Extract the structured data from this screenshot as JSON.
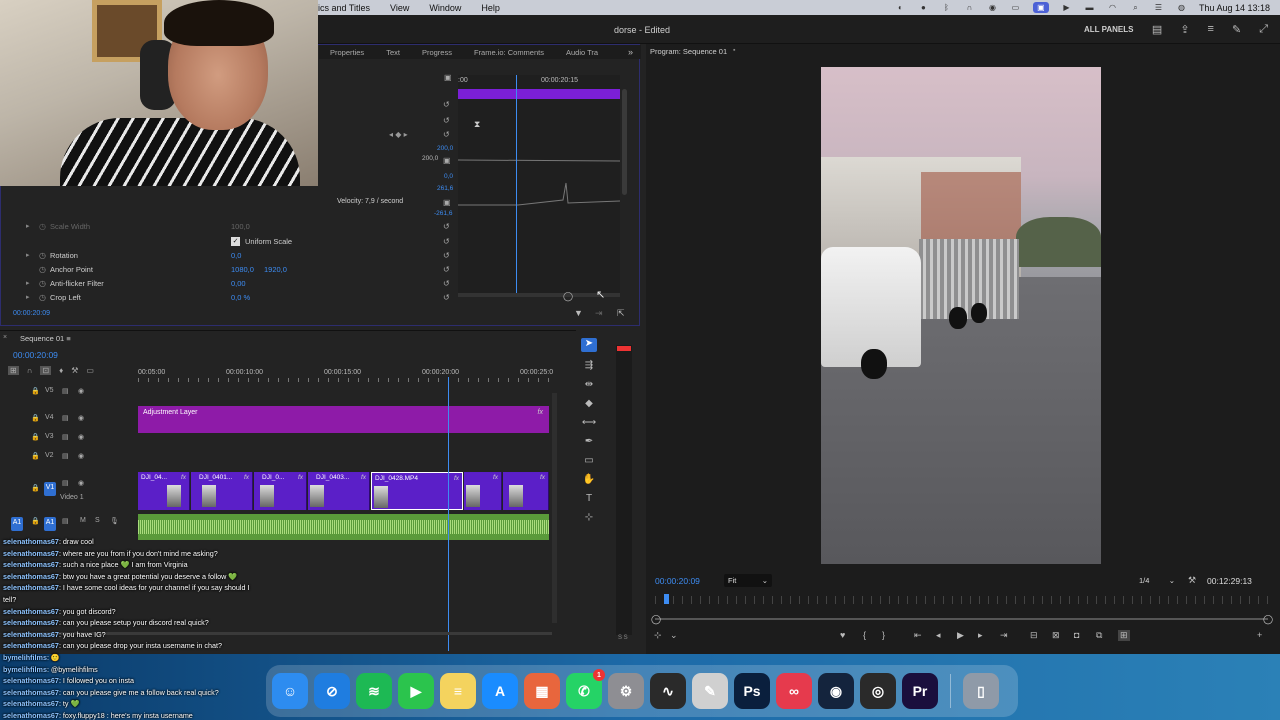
{
  "menubar": {
    "items": [
      "ics and Titles",
      "View",
      "Window",
      "Help"
    ],
    "clock": "Thu Aug 14  13:18"
  },
  "titlebar": {
    "project": "dorse - Edited",
    "all_panels": "ALL PANELS"
  },
  "effects_panel": {
    "tabs": [
      "Properties",
      "Text",
      "Progress",
      "Frame.io: Comments",
      "Audio Tra"
    ],
    "ruler_start": ":00",
    "ruler_time": "00:00:20:15",
    "values_right": [
      "200,0",
      "200,0",
      "0,0",
      "261,6",
      "-261,6"
    ],
    "velocity": "Velocity: 7,9 / second",
    "rows": [
      {
        "name": "Scale Width",
        "value": "100,0",
        "dim": true
      },
      {
        "name": "Uniform Scale",
        "checkbox": true
      },
      {
        "name": "Rotation",
        "value": "0,0"
      },
      {
        "name": "Anchor Point",
        "value": "1080,0",
        "value2": "1920,0"
      },
      {
        "name": "Anti-flicker Filter",
        "value": "0,00"
      },
      {
        "name": "Crop Left",
        "value": "0,0 %"
      }
    ],
    "current_time": "00:00:20:09"
  },
  "program": {
    "title": "Program: Sequence 01",
    "timecode": "00:00:20:09",
    "fit": "Fit",
    "resolution": "1/4",
    "duration": "00:12:29:13"
  },
  "timeline": {
    "sequence": "Sequence 01",
    "timecode": "00:00:20:09",
    "ruler": [
      "00:05:00",
      "00:00:10:00",
      "00:00:15:00",
      "00:00:20:00",
      "00:00:25:0"
    ],
    "tracks": [
      "V5",
      "V4",
      "V3",
      "V2",
      "V1",
      "A1"
    ],
    "v1_name": "Video 1",
    "target_v": "V1",
    "target_a": "A1",
    "audio_flags": [
      "M",
      "S"
    ],
    "adjustment_layer": "Adjustment Layer",
    "clips": [
      "DJI_04...",
      "DJI_0401...",
      "DJI_0...",
      "DJI_0403...",
      "DJI_0428.MP4"
    ],
    "fx": "fx"
  },
  "meter": {
    "label": "S S"
  },
  "chat": [
    {
      "user": "selenathomas67",
      "text": ": draw cool"
    },
    {
      "user": "selenathomas67",
      "text": ": where are you from if you don't mind me asking?"
    },
    {
      "user": "selenathomas67",
      "text": ": such a nice place 💚 I am from Virginia"
    },
    {
      "user": "selenathomas67",
      "text": ": btw you have a great potential you deserve a follow 💚"
    },
    {
      "user": "selenathomas67",
      "text": ": I have some cool ideas for your channel if you say should I"
    },
    {
      "user": "",
      "text": "tell?"
    },
    {
      "user": "selenathomas67",
      "text": ": you got discord?"
    },
    {
      "user": "selenathomas67",
      "text": ": can you please setup your discord real quick?"
    },
    {
      "user": "selenathomas67",
      "text": ": you have IG?"
    },
    {
      "user": "selenathomas67",
      "text": ": can you please drop your insta username in chat?"
    },
    {
      "user": "bymelihfilms",
      "text": ": 🙂"
    },
    {
      "user": "bymelihfilms",
      "text": ": @bymelihfilms"
    },
    {
      "user": "selenathomas67",
      "text": ": I followed you on insta"
    },
    {
      "user": "selenathomas67",
      "text": ": can you please give me a follow back real quick?"
    },
    {
      "user": "selenathomas67",
      "text": ": ty 💚"
    },
    {
      "user": "selenathomas67",
      "text": ": foxy.fluppy18 : here's my insta username"
    }
  ],
  "dock": {
    "apps": [
      {
        "name": "finder",
        "glyph": "☺",
        "color": "#2d8cf0"
      },
      {
        "name": "safari",
        "glyph": "⊘",
        "color": "#1f7de0"
      },
      {
        "name": "spotify",
        "glyph": "≋",
        "color": "#1db954"
      },
      {
        "name": "facetime",
        "glyph": "▶",
        "color": "#2bc44d"
      },
      {
        "name": "notes",
        "glyph": "≡",
        "color": "#f4d35e"
      },
      {
        "name": "app-store",
        "glyph": "A",
        "color": "#1a8cff"
      },
      {
        "name": "launchpad",
        "glyph": "▦",
        "color": "#e8663d"
      },
      {
        "name": "whatsapp",
        "glyph": "✆",
        "color": "#25d366",
        "badge": "1"
      },
      {
        "name": "system-settings",
        "glyph": "⚙",
        "color": "#8e8e93"
      },
      {
        "name": "activity-monitor",
        "glyph": "∿",
        "color": "#2a2a2a"
      },
      {
        "name": "pencil-app",
        "glyph": "✎",
        "color": "#d0d0d0"
      },
      {
        "name": "photoshop",
        "glyph": "Ps",
        "color": "#0a1f3d"
      },
      {
        "name": "creative-cloud",
        "glyph": "∞",
        "color": "#e63a4d"
      },
      {
        "name": "steam",
        "glyph": "◉",
        "color": "#14243d"
      },
      {
        "name": "obs",
        "glyph": "◎",
        "color": "#2a2a2a"
      },
      {
        "name": "premiere-pro",
        "glyph": "Pr",
        "color": "#1a0f3d"
      },
      {
        "name": "trash",
        "glyph": "▯",
        "color": "#8f9aa8"
      }
    ]
  }
}
